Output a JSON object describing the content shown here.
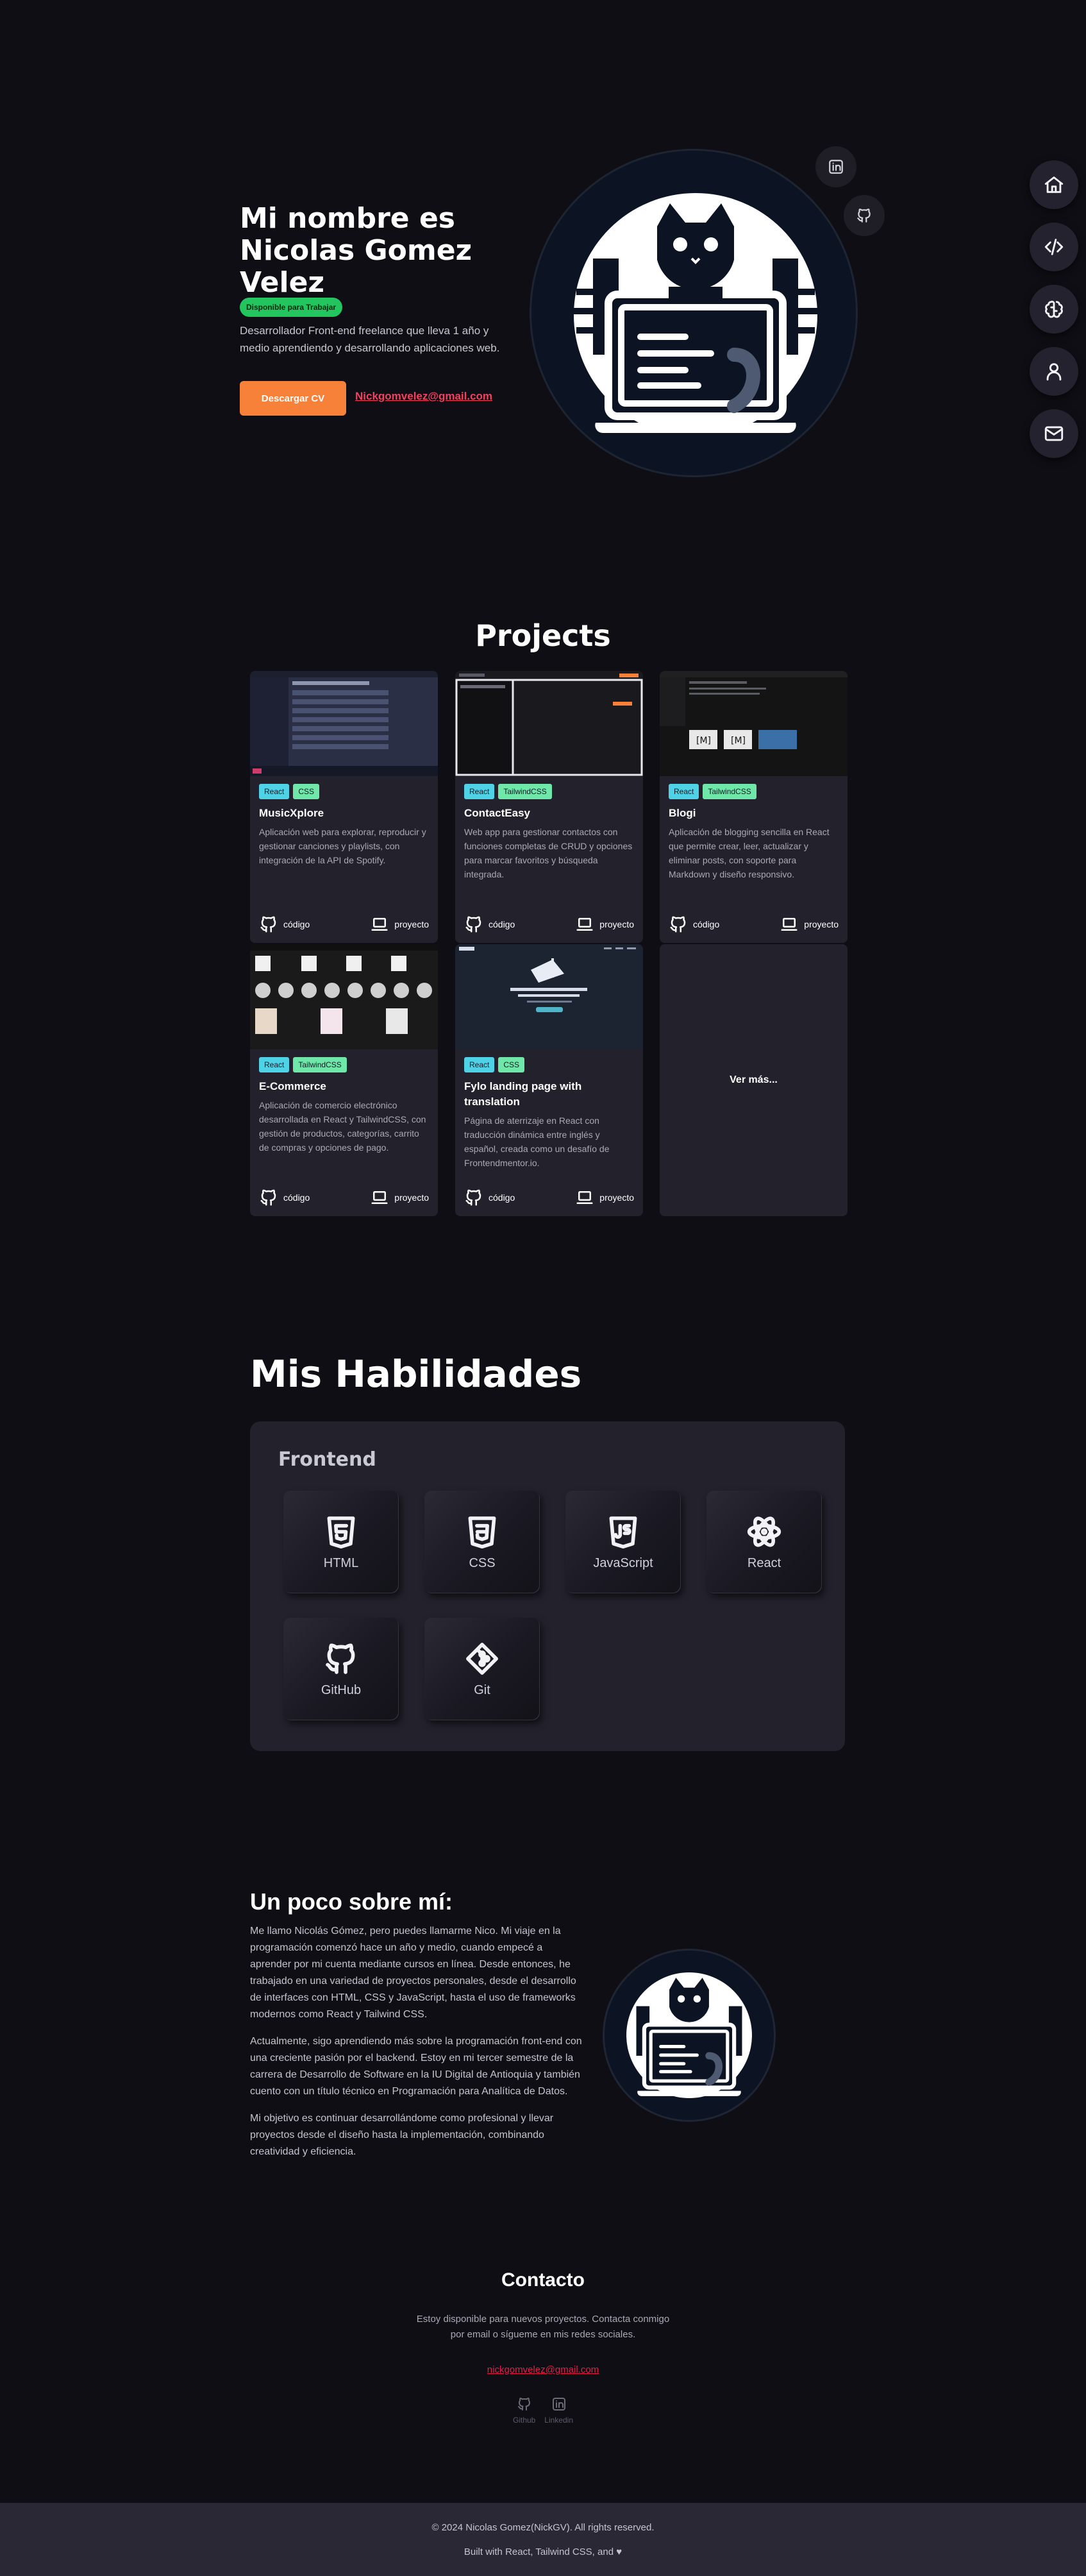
{
  "nav": {
    "items": [
      {
        "icon": "home-icon"
      },
      {
        "icon": "code-icon"
      },
      {
        "icon": "brain-icon"
      },
      {
        "icon": "user-icon"
      },
      {
        "icon": "mail-icon"
      }
    ]
  },
  "hero": {
    "title": "Mi nombre es Nicolas Gomez Velez",
    "badge": "Disponible para Trabajar",
    "description": "Desarrollador Front-end freelance que lleva 1 año y medio aprendiendo y desarrollando aplicaciones web.",
    "cv_button": "Descargar CV",
    "email": "Nickgomvelez@gmail.com",
    "social_icons": [
      "linkedin-icon",
      "github-icon"
    ]
  },
  "projects": {
    "title": "Projects",
    "code_label": "código",
    "project_label": "proyecto",
    "more_label": "Ver más...",
    "items": [
      {
        "tags": [
          "React",
          "CSS"
        ],
        "title": "MusicXplore",
        "description": "Aplicación web para explorar, reproducir y gestionar canciones y playlists, con integración de la API de Spotify."
      },
      {
        "tags": [
          "React",
          "TailwindCSS"
        ],
        "title": "ContactEasy",
        "description": "Web app para gestionar contactos con funciones completas de CRUD y opciones para marcar favoritos y búsqueda integrada."
      },
      {
        "tags": [
          "React",
          "TailwindCSS"
        ],
        "title": "Blogi",
        "description": "Aplicación de blogging sencilla en React que permite crear, leer, actualizar y eliminar posts, con soporte para Markdown y diseño responsivo."
      },
      {
        "tags": [
          "React",
          "TailwindCSS"
        ],
        "title": "E-Commerce",
        "description": "Aplicación de comercio electrónico desarrollada en React y TailwindCSS, con gestión de productos, categorías, carrito de compras y opciones de pago."
      },
      {
        "tags": [
          "React",
          "CSS"
        ],
        "title": "Fylo landing page with translation",
        "description": "Página de aterrizaje en React con traducción dinámica entre inglés y español, creada como un desafío de Frontendmentor.io."
      }
    ]
  },
  "skills": {
    "title": "Mis Habilidades",
    "category": "Frontend",
    "items": [
      {
        "label": "HTML",
        "icon": "html5-icon"
      },
      {
        "label": "CSS",
        "icon": "css3-icon"
      },
      {
        "label": "JavaScript",
        "icon": "javascript-icon"
      },
      {
        "label": "React",
        "icon": "react-icon"
      },
      {
        "label": "GitHub",
        "icon": "github-icon"
      },
      {
        "label": "Git",
        "icon": "git-icon"
      }
    ]
  },
  "about": {
    "title": "Un poco sobre mí:",
    "paragraphs": [
      "Me llamo Nicolás Gómez, pero puedes llamarme Nico. Mi viaje en la programación comenzó hace un año y medio, cuando empecé a aprender por mi cuenta mediante cursos en línea. Desde entonces, he trabajado en una variedad de proyectos personales, desde el desarrollo de interfaces con HTML, CSS y JavaScript, hasta el uso de frameworks modernos como React y Tailwind CSS.",
      "Actualmente, sigo aprendiendo más sobre la programación front-end con una creciente pasión por el backend. Estoy en mi tercer semestre de la carrera de Desarrollo de Software en la IU Digital de Antioquia y también cuento con un título técnico en Programación para Analítica de Datos.",
      "Mi objetivo es continuar desarrollándome como profesional y llevar proyectos desde el diseño hasta la implementación, combinando creatividad y eficiencia."
    ]
  },
  "contact": {
    "title": "Contacto",
    "text": "Estoy disponible para nuevos proyectos. Contacta conmigo por email o sígueme en mis redes sociales.",
    "email": "nickgomvelez@gmail.com",
    "github_label": "Github",
    "linkedin_label": "Linkedin"
  },
  "footer": {
    "copyright": "© 2024 Nicolas Gomez(NickGV). All rights reserved.",
    "built_with": "Built with React, Tailwind CSS, and ♥"
  },
  "colors": {
    "background": "#0f0e15",
    "card": "#23212c",
    "accent_orange": "#f8813a",
    "accent_pink": "#f43f5e",
    "badge_green": "#22c55e"
  }
}
